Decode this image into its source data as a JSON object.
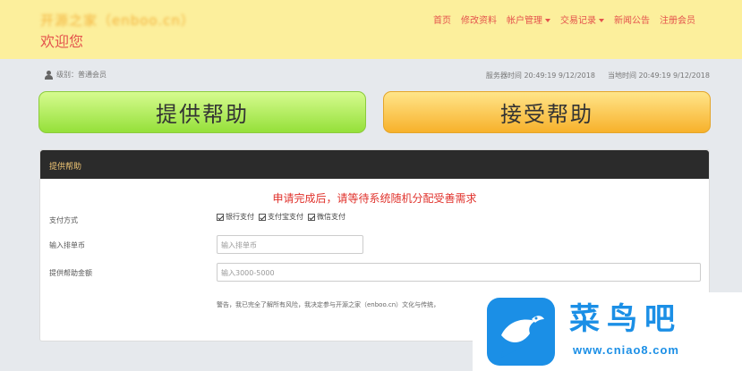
{
  "header": {
    "brand": "开源之家（enboo.cn）",
    "welcome": "欢迎您",
    "nav": [
      {
        "label": "首页",
        "dropdown": false
      },
      {
        "label": "修改资料",
        "dropdown": false
      },
      {
        "label": "帐户管理",
        "dropdown": true
      },
      {
        "label": "交易记录",
        "dropdown": true
      },
      {
        "label": "新闻公告",
        "dropdown": false
      },
      {
        "label": "注册会员",
        "dropdown": false
      }
    ]
  },
  "info": {
    "level": "级别：普通会员",
    "server_time": "服务器时间  20:49:19 9/12/2018",
    "local_time": "当地时间  20:49:19 9/12/2018"
  },
  "actions": {
    "offer_help": "提供帮助",
    "accept_help": "接受帮助"
  },
  "panel": {
    "title": "提供帮助",
    "notice": "申请完成后，请等待系统随机分配受善需求",
    "payment_label": "支付方式",
    "payment_options": [
      "银行支付",
      "支付宝支付",
      "微信支付"
    ],
    "coin_label": "输入排单币",
    "coin_placeholder": "输入排单币",
    "amount_label": "提供帮助金额",
    "amount_placeholder": "输入3000-5000",
    "disclaimer": "警告，我已完全了解所有风险，我决定参与开源之家（enboo.cn）文化与传统，"
  },
  "watermark": {
    "text": "菜鸟吧",
    "url": "www.cniao8.com"
  },
  "colors": {
    "header_bg": "#fcef9c",
    "accent_red": "#e4534d",
    "offer_green": "#95e03a",
    "accept_orange": "#f7b12b",
    "panel_head": "#2b2b2b",
    "watermark_blue": "#1b8fe6"
  }
}
